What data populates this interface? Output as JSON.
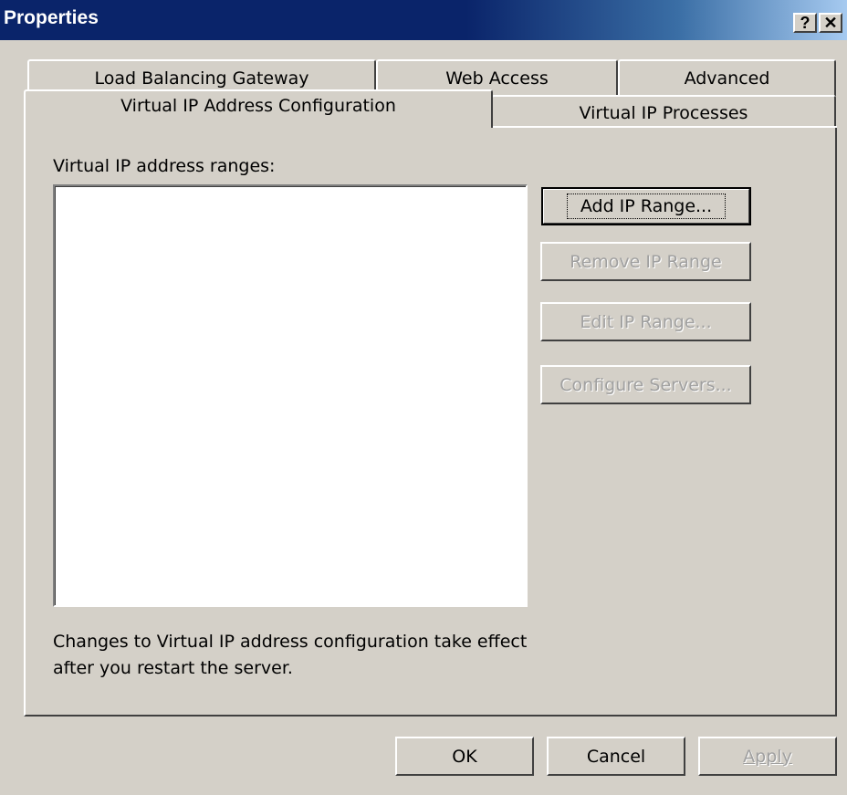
{
  "window": {
    "title": "Properties",
    "help_label": "?",
    "close_label": "✕"
  },
  "tabs": {
    "back_row": [
      "Load Balancing Gateway",
      "Web Access",
      "Advanced"
    ],
    "front_row": [
      "Virtual IP Address Configuration",
      "Virtual IP Processes"
    ],
    "selected": "Virtual IP Address Configuration"
  },
  "panel": {
    "ranges_label": "Virtual IP address ranges:",
    "ranges": [],
    "buttons": {
      "add": "Add IP Range...",
      "remove": "Remove IP Range",
      "edit": "Edit IP Range...",
      "configure": "Configure Servers..."
    },
    "note_line1": "Changes to Virtual IP address configuration take effect",
    "note_line2": "after you restart the server."
  },
  "footer": {
    "ok": "OK",
    "cancel": "Cancel",
    "apply": "Apply"
  }
}
